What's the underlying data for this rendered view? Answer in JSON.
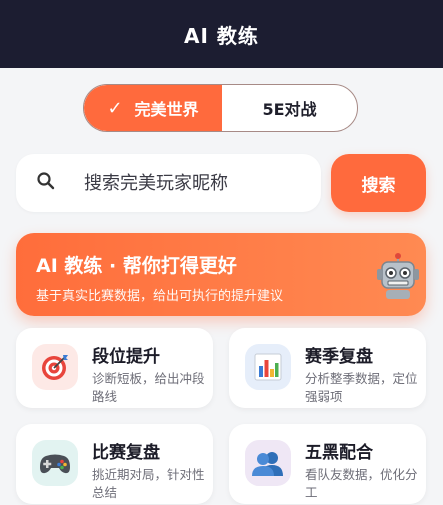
{
  "header": {
    "title": "AI 教练"
  },
  "segment": {
    "tabs": [
      {
        "label": "完美世界",
        "active": true,
        "icon": "check-icon"
      },
      {
        "label": "5E对战",
        "active": false
      }
    ]
  },
  "search": {
    "placeholder": "搜索完美玩家昵称",
    "icon": "search-icon",
    "button_label": "搜索"
  },
  "banner": {
    "title": "AI 教练 · 帮你打得更好",
    "subtitle": "基于真实比赛数据，给出可执行的提升建议",
    "icon": "robot-icon"
  },
  "cards": [
    {
      "title": "段位提升",
      "desc": "诊断短板，给出冲段路线",
      "icon": "target-icon"
    },
    {
      "title": "赛季复盘",
      "desc": "分析整季数据，定位强弱项",
      "icon": "bar-chart-icon"
    },
    {
      "title": "比赛复盘",
      "desc": "挑近期对局，针对性总结",
      "icon": "gamepad-icon"
    },
    {
      "title": "五黑配合",
      "desc": "看队友数据，优化分工",
      "icon": "team-icon"
    }
  ],
  "colors": {
    "accent": "#ff6a3d",
    "header_bg": "#1c1d31",
    "page_bg": "#f4f5f7"
  }
}
